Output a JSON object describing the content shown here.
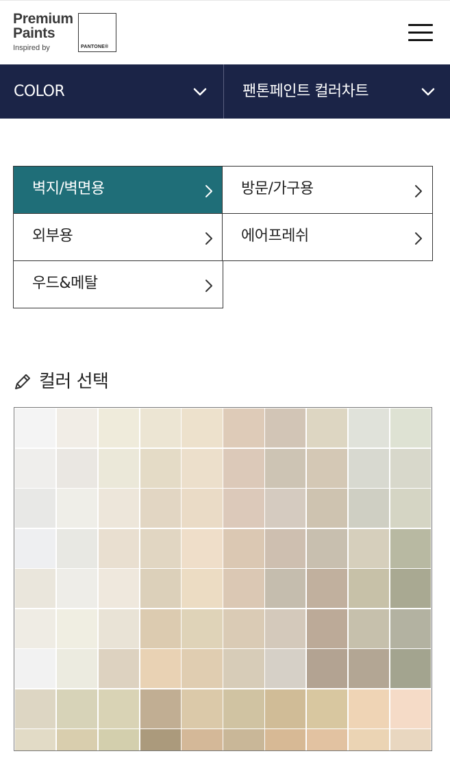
{
  "header": {
    "brand_line1": "Premium",
    "brand_line2": "Paints",
    "inspired_text": "Inspired by",
    "pantone_text": "PANTONE®",
    "menu_icon": "hamburger-menu-icon"
  },
  "nav": {
    "left_dropdown": {
      "label": "COLOR",
      "icon": "chevron-down-icon"
    },
    "right_dropdown": {
      "label": "팬톤페인트 컬러차트",
      "icon": "chevron-down-icon"
    },
    "background_color": "#1b2447"
  },
  "categories": [
    {
      "label": "벽지/벽면용",
      "active": true
    },
    {
      "label": "방문/가구용",
      "active": false
    },
    {
      "label": "외부용",
      "active": false
    },
    {
      "label": "에어프레쉬",
      "active": false
    },
    {
      "label": "우드&메탈",
      "active": false
    }
  ],
  "active_category_color": "#1f6e78",
  "section": {
    "title": "컬러 선택",
    "icon": "pencil-icon"
  },
  "swatches": [
    [
      "#f4f4f4",
      "#f1ede6",
      "#efebdb",
      "#ece5d3",
      "#ede1cc",
      "#decbb8",
      "#d2c5b6",
      "#ddd6c2",
      "#e0e2da",
      "#dee2d3"
    ],
    [
      "#efeeec",
      "#eae7e2",
      "#ebe8d9",
      "#e4dbc6",
      "#ecdfcb",
      "#dcc9b9",
      "#cdc4b4",
      "#d4c8b5",
      "#d8d9d0",
      "#d8d8cb"
    ],
    [
      "#e8e8e6",
      "#efeee8",
      "#ede6da",
      "#e2d6c3",
      "#eadbc6",
      "#dcc9ba",
      "#d5cbc0",
      "#cec3b0",
      "#cfcfc3",
      "#d5d5c4"
    ],
    [
      "#eeeff1",
      "#e8e8e3",
      "#e9dfd0",
      "#e1d6c2",
      "#efdec9",
      "#dbc8b3",
      "#cebfb0",
      "#c8bfaf",
      "#d6cfbc",
      "#b8b9a2"
    ],
    [
      "#eae6dc",
      "#eeede8",
      "#efe8dd",
      "#dcd0ba",
      "#ecdcc3",
      "#dbc8b4",
      "#c5bdae",
      "#c1b09e",
      "#c7c1a8",
      "#a9a992"
    ],
    [
      "#efece4",
      "#f0eee2",
      "#e9e3d6",
      "#dccbb0",
      "#dfd3b8",
      "#dacbb5",
      "#d4c9bb",
      "#bcaa98",
      "#c6c0ac",
      "#b3b2a1"
    ],
    [
      "#f2f2f2",
      "#ecebe0",
      "#ddd2c0",
      "#e9d2b4",
      "#e0cdb1",
      "#d7ccb8",
      "#d6d0c7",
      "#b3a392",
      "#b3a694",
      "#a3a48f"
    ],
    [
      "#ddd6c3",
      "#d7d3b8",
      "#d9d3b5",
      "#c1ae93",
      "#dbc9a9",
      "#d0c3a2",
      "#d0bc97",
      "#d8c7a0",
      "#efd4b5",
      "#f5dbc7"
    ],
    [
      "#e2dbc6",
      "#d9ceae",
      "#d3cfad",
      "#ab9a7c",
      "#d4b898",
      "#c9b798",
      "#d7b995",
      "#e2c2a1",
      "#ebd4b4",
      "#e9d7c0"
    ]
  ]
}
